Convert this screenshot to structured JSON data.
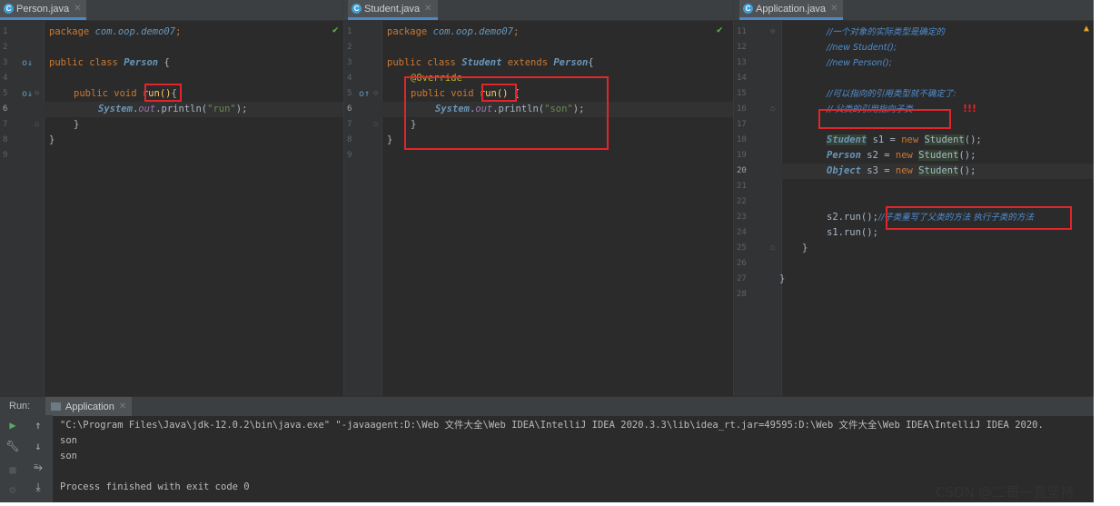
{
  "panes": {
    "person": {
      "tab": "Person.java",
      "lines": [
        "1",
        "2",
        "3",
        "4",
        "5",
        "6",
        "7",
        "8",
        "9"
      ],
      "code": {
        "l1": [
          "package ",
          "com.oop.demo07",
          ";"
        ],
        "l3": [
          "public class ",
          "Person",
          " {"
        ],
        "l5": [
          "public void ",
          "run()",
          "{"
        ],
        "l6": [
          "System",
          ".",
          "out",
          ".println(",
          "\"run\"",
          ");"
        ],
        "l7": "}",
        "l8": "}"
      }
    },
    "student": {
      "tab": "Student.java",
      "lines": [
        "1",
        "2",
        "3",
        "4",
        "5",
        "6",
        "7",
        "8",
        "9"
      ],
      "code": {
        "l1": [
          "package ",
          "com.oop.demo07",
          ";"
        ],
        "l3": [
          "public class ",
          "Student",
          " extends ",
          "Person",
          "{"
        ],
        "l4": "@Override",
        "l5": [
          "public void ",
          "run()",
          " {"
        ],
        "l6": [
          "System",
          ".",
          "out",
          ".println(",
          "\"son\"",
          ");"
        ],
        "l7": "}",
        "l8": "}"
      }
    },
    "application": {
      "tab": "Application.java",
      "lines": [
        "11",
        "12",
        "13",
        "14",
        "15",
        "16",
        "17",
        "18",
        "19",
        "20",
        "21",
        "22",
        "23",
        "24",
        "25",
        "26",
        "27",
        "28"
      ],
      "code": {
        "l11": "//一个对象的实际类型是确定的",
        "l12": "//new Student();",
        "l13": "//new Person();",
        "l15": "//可以指向的引用类型就不确定了:",
        "l16": "// 父类的引用指向子类",
        "l16_mark": "!!!",
        "l18": [
          "Student",
          " s1 = ",
          "new ",
          "Student",
          "();"
        ],
        "l19": [
          "Person",
          " s2 = ",
          "new ",
          "Student",
          "();"
        ],
        "l20": [
          "Object",
          " s3 = ",
          "new ",
          "Student",
          "();"
        ],
        "l23": [
          "s2.run();",
          "//子类重写了父类的方法 执行子类的方法"
        ],
        "l24": "s1.run();",
        "l25": "}",
        "l27": "}"
      }
    }
  },
  "run": {
    "label": "Run:",
    "tab": "Application",
    "output": [
      "\"C:\\Program Files\\Java\\jdk-12.0.2\\bin\\java.exe\" \"-javaagent:D:\\Web 文件大全\\Web IDEA\\IntelliJ IDEA 2020.3.3\\lib\\idea_rt.jar=49595:D:\\Web 文件大全\\Web IDEA\\IntelliJ IDEA 2020.",
      "son",
      "son",
      "",
      "Process finished with exit code 0"
    ]
  },
  "watermark": "CSDN @二哥一直坚持",
  "colors": {
    "highlight_box": "#e0262b",
    "background": "#2b2b2b",
    "keyword": "#cc7832"
  }
}
